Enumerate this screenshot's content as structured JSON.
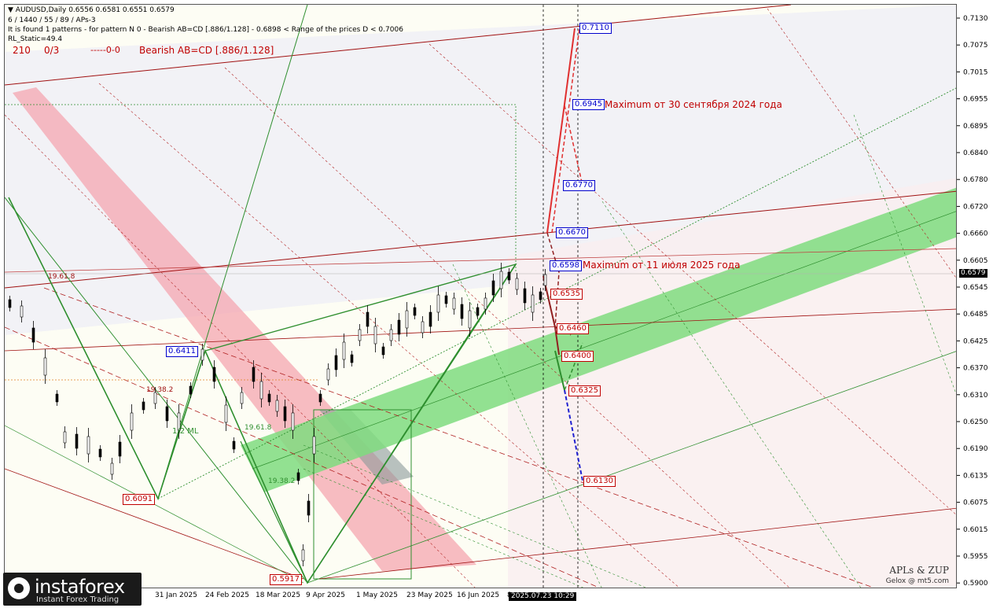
{
  "header": {
    "symbol_line": "AUDUSD,Daily  0.6556 0.6581 0.6551 0.6579",
    "params_line": "6 / 1440 / 55 / 89 / APs-3",
    "pattern_line": "It is found 1 patterns  -  for pattern N 0 - Bearish AB=CD [.886/1.128] - 0.6898 < Range of the prices D < 0.7006",
    "static_line": "RL_Static=49.4",
    "counter1": "210",
    "counter2": "0/3",
    "counter3": "-----0-0",
    "pattern_name": "Bearish AB=CD [.886/1.128]"
  },
  "price_axis": {
    "ticks": [
      "0.7130",
      "0.7075",
      "0.7015",
      "0.6955",
      "0.6895",
      "0.6840",
      "0.6780",
      "0.6720",
      "0.6660",
      "0.6605",
      "0.6545",
      "0.6485",
      "0.6425",
      "0.6370",
      "0.6310",
      "0.6250",
      "0.6190",
      "0.6135",
      "0.6075",
      "0.6015",
      "0.5955",
      "0.5900"
    ],
    "current_price": "0.6579"
  },
  "time_axis": {
    "labels": [
      "31 Jan 2025",
      "24 Feb 2025",
      "18 Mar 2025",
      "9 Apr 2025",
      "1 May 2025",
      "23 May 2025",
      "16 Jun 2025",
      "8"
    ],
    "cursor_date": "2025.07.23 10:29"
  },
  "price_levels": [
    {
      "value": "0.7110",
      "color": "blue"
    },
    {
      "value": "0.6945",
      "color": "blue"
    },
    {
      "value": "0.6770",
      "color": "blue"
    },
    {
      "value": "0.6670",
      "color": "blue"
    },
    {
      "value": "0.6598",
      "color": "blue"
    },
    {
      "value": "0.6535",
      "color": "red"
    },
    {
      "value": "0.6460",
      "color": "red"
    },
    {
      "value": "0.6400",
      "color": "red"
    },
    {
      "value": "0.6325",
      "color": "red"
    },
    {
      "value": "0.6130",
      "color": "red"
    }
  ],
  "pivots": {
    "p1": "0.6411",
    "p2": "0.6091",
    "p3": "0.5917"
  },
  "annotations": {
    "max_2024": "Maximum от 30 сентября 2024 года",
    "max_2025": "Maximum от 11 июля 2025 года",
    "ml_label": "1/2 ML"
  },
  "signature": {
    "line1": "APLs & ZUP",
    "line2": "Gelox @ mt5.com"
  },
  "logo": {
    "name": "instaforex",
    "tagline": "Instant Forex Trading"
  },
  "colors": {
    "bg": "#fdfdf4",
    "red_zone": "#f4a6b0",
    "green_zone": "#7fdc7f",
    "blue_label": "#0000cc",
    "red_label": "#c00000",
    "candle": "#000000"
  }
}
